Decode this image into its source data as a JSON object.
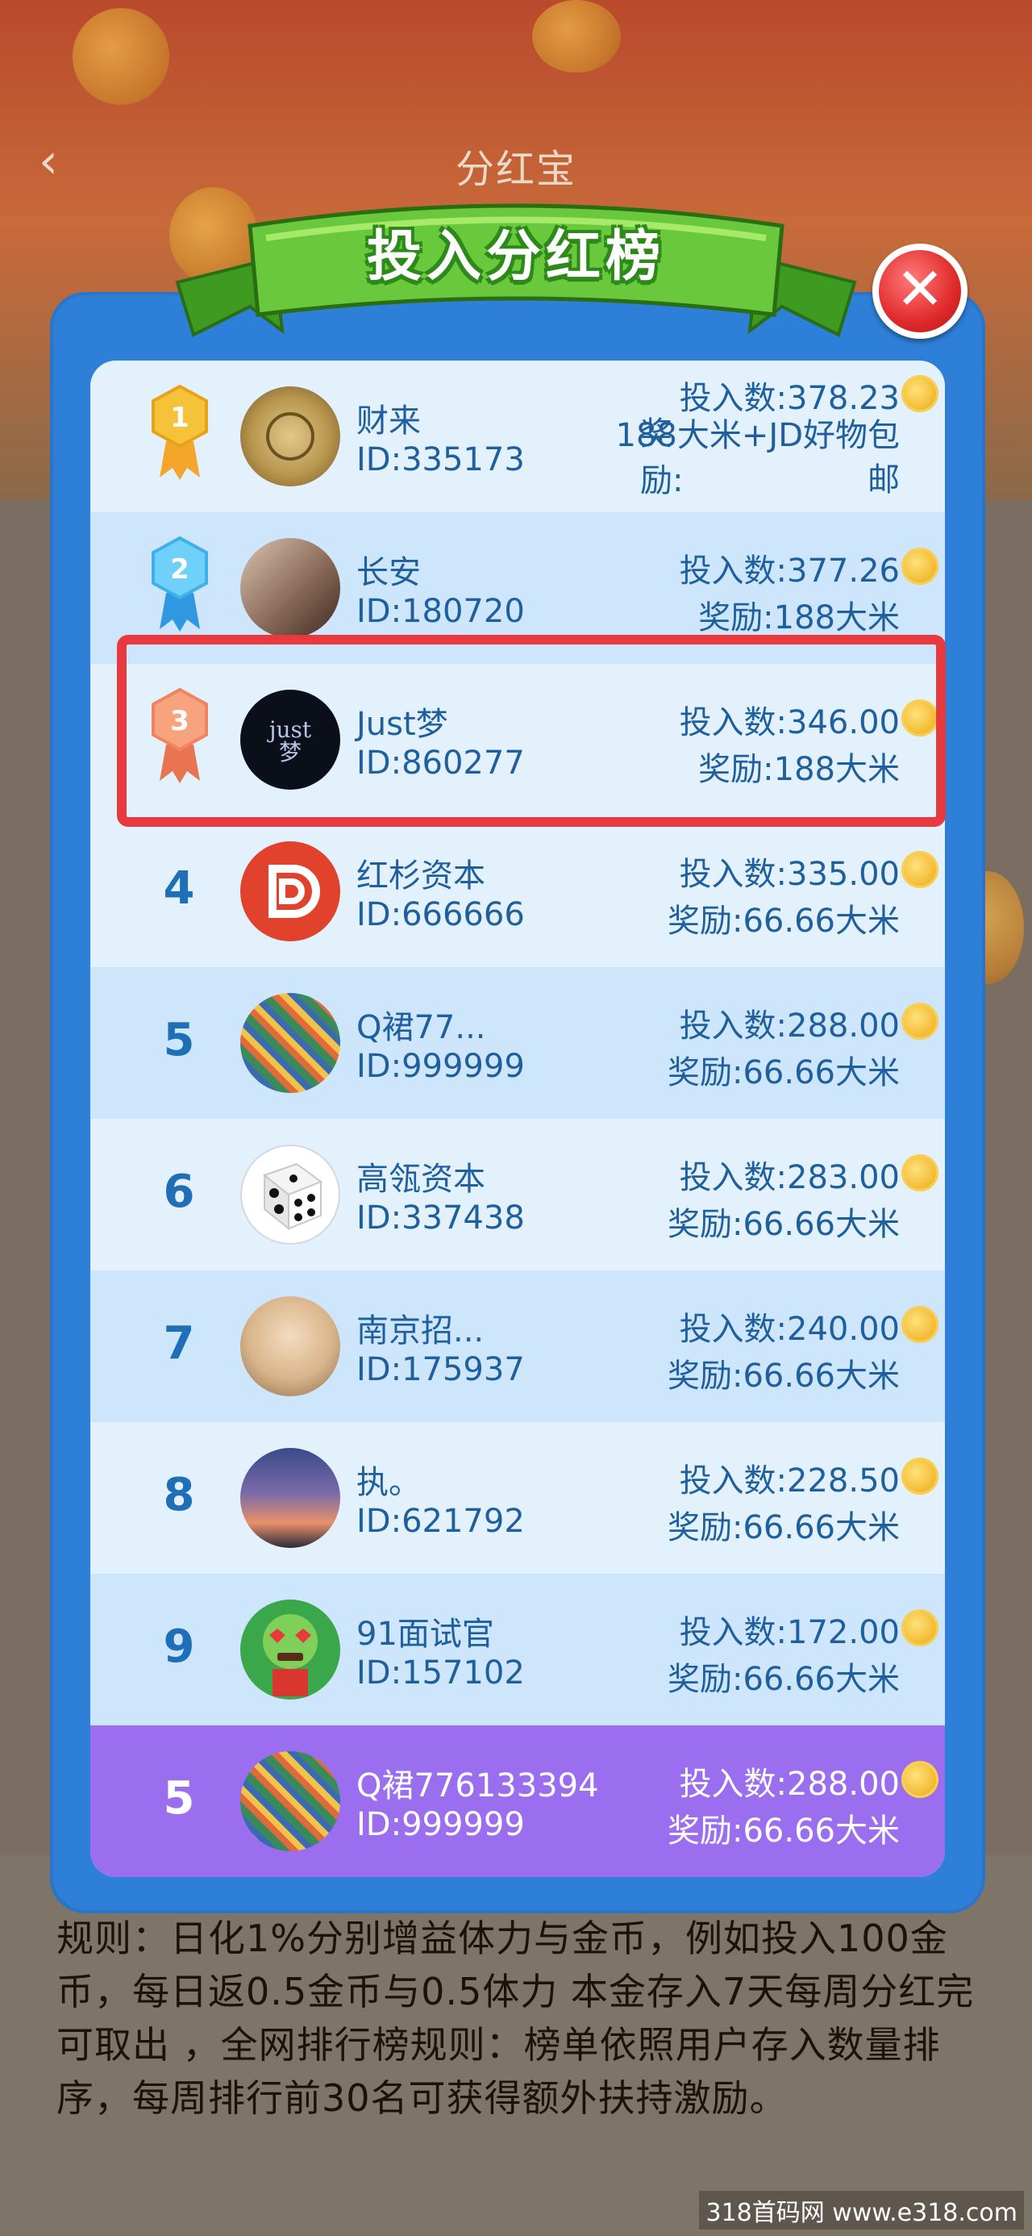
{
  "header": {
    "back_icon": "chevron-left-icon",
    "title": "分红宝"
  },
  "banner": {
    "title": "投入分红榜"
  },
  "close_icon": "close-icon",
  "rows": [
    {
      "rank": "1",
      "name": "财来",
      "id": "ID:335173",
      "amount": "投入数:378.23",
      "reward_label": "奖励:",
      "reward": "188大米+JD好物包邮",
      "medal_color": "#f0b52e"
    },
    {
      "rank": "2",
      "name": "长安",
      "id": "ID:180720",
      "amount": "投入数:377.26",
      "reward": "奖励:188大米",
      "medal_color": "#4cb8f0"
    },
    {
      "rank": "3",
      "name": "Just梦",
      "id": "ID:860277",
      "amount": "投入数:346.00",
      "reward": "奖励:188大米",
      "medal_color": "#f28a6a",
      "avatar_text": "just\n梦"
    },
    {
      "rank": "4",
      "name": "红杉资本",
      "id": "ID:666666",
      "amount": "投入数:335.00",
      "reward": "奖励:66.66大米"
    },
    {
      "rank": "5",
      "name": "Q裙77...",
      "id": "ID:999999",
      "amount": "投入数:288.00",
      "reward": "奖励:66.66大米"
    },
    {
      "rank": "6",
      "name": "高瓴资本",
      "id": "ID:337438",
      "amount": "投入数:283.00",
      "reward": "奖励:66.66大米"
    },
    {
      "rank": "7",
      "name": "南京招...",
      "id": "ID:175937",
      "amount": "投入数:240.00",
      "reward": "奖励:66.66大米"
    },
    {
      "rank": "8",
      "name": "执。",
      "id": "ID:621792",
      "amount": "投入数:228.50",
      "reward": "奖励:66.66大米"
    },
    {
      "rank": "9",
      "name": "91面试官",
      "id": "ID:157102",
      "amount": "投入数:172.00",
      "reward": "奖励:66.66大米"
    }
  ],
  "me": {
    "rank": "5",
    "name": "Q裙776133394",
    "id": "ID:999999",
    "amount": "投入数:288.00",
    "reward": "奖励:66.66大米"
  },
  "rules": "规则：日化1%分别增益体力与金币，例如投入100金币，每日返0.5金币与0.5体力  本金存入7天每周分红完可取出 ，全网排行榜规则：榜单依照用户存入数量排序，每周排行前30名可获得额外扶持激励。",
  "watermark": "318首码网 www.e318.com",
  "colors": {
    "modal_blue": "#2e7fd8",
    "row_light": "#e3f1fd",
    "row_dark": "#cde6fb",
    "me_purple": "#9b6ef0",
    "highlight_red": "#e8393f"
  }
}
